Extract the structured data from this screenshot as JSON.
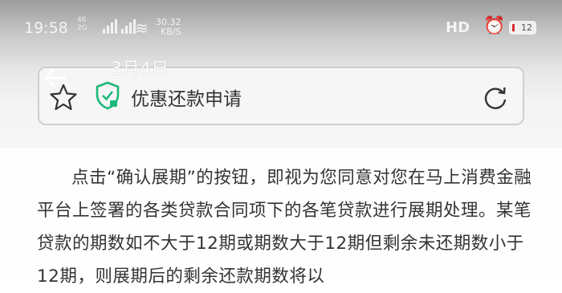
{
  "status_bar": {
    "time": "19:58",
    "network_top": "46",
    "network_bottom": "2G",
    "speed_top": "30.32",
    "speed_bottom": "KB/S",
    "hd_label": "HD",
    "battery_level": "12"
  },
  "overlay": {
    "date": "3月4日"
  },
  "browser": {
    "page_title": "优惠还款申请"
  },
  "content": {
    "paragraph": "点击“确认展期”的按钮，即视为您同意对您在马上消费金融平台上签署的各类贷款合同项下的各笔贷款进行展期处理。某笔贷款的期数如不大于12期或期数大于12期但剩余未还期数小于12期，则展期后的剩余还款期数将以"
  },
  "colors": {
    "shield_green": "#1db87a",
    "battery_low": "#d72a2a"
  }
}
